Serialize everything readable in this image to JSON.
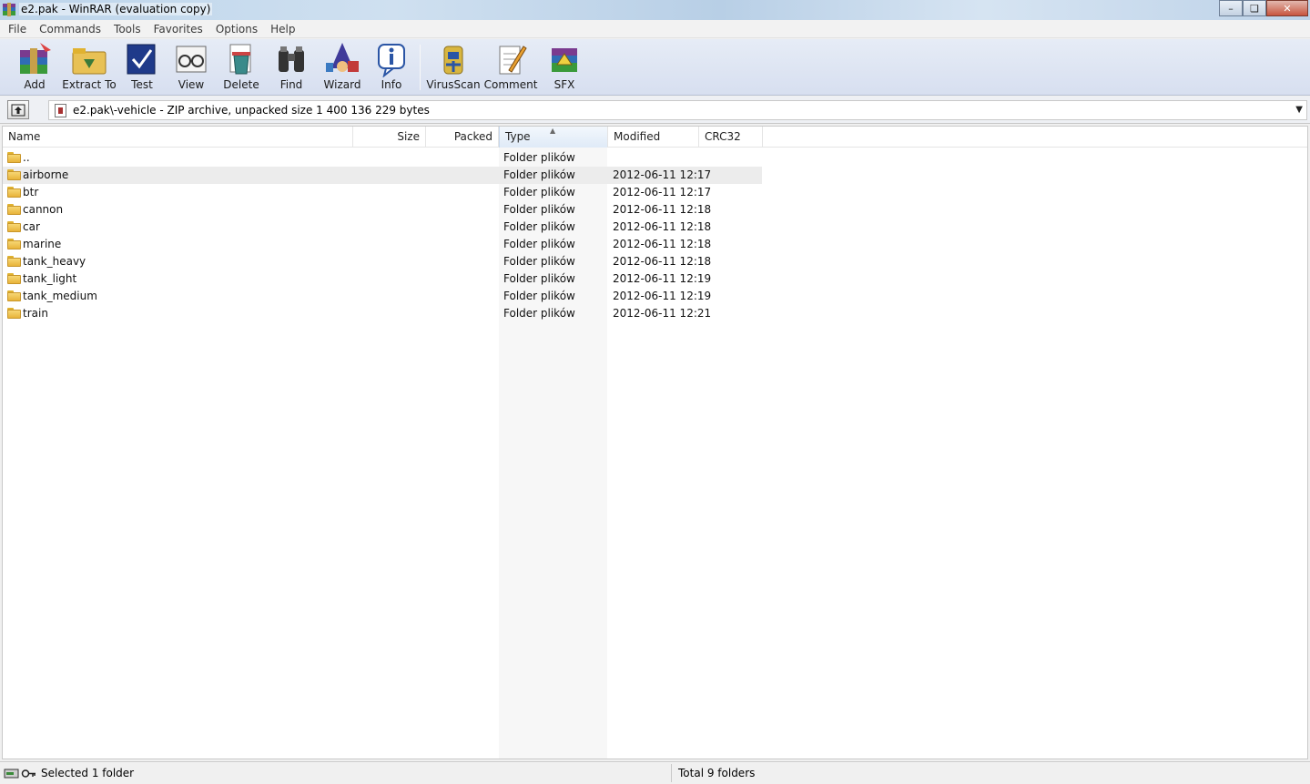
{
  "window": {
    "title": "e2.pak - WinRAR (evaluation copy)",
    "minimize_glyph": "–",
    "maximize_glyph": "❏",
    "close_glyph": "✕"
  },
  "menu": [
    "File",
    "Commands",
    "Tools",
    "Favorites",
    "Options",
    "Help"
  ],
  "toolbar": [
    {
      "label": "Add",
      "icon": "add-archive-icon"
    },
    {
      "label": "Extract To",
      "icon": "extract-to-icon"
    },
    {
      "label": "Test",
      "icon": "test-icon"
    },
    {
      "label": "View",
      "icon": "view-icon"
    },
    {
      "label": "Delete",
      "icon": "delete-icon"
    },
    {
      "label": "Find",
      "icon": "find-binoculars-icon"
    },
    {
      "label": "Wizard",
      "icon": "wizard-icon"
    },
    {
      "label": "Info",
      "icon": "info-icon"
    },
    {
      "label": "VirusScan",
      "icon": "virusscan-icon"
    },
    {
      "label": "Comment",
      "icon": "comment-icon"
    },
    {
      "label": "SFX",
      "icon": "sfx-icon"
    }
  ],
  "address": {
    "path": "e2.pak\\-vehicle - ZIP archive, unpacked size 1 400 136 229 bytes",
    "dropdown_glyph": "▼"
  },
  "columns": {
    "name": "Name",
    "size": "Size",
    "packed": "Packed",
    "type": "Type",
    "modified": "Modified",
    "crc": "CRC32"
  },
  "sort_arrow": "▲",
  "rows": [
    {
      "name": "..",
      "type": "Folder plików",
      "modified": ""
    },
    {
      "name": "airborne",
      "type": "Folder plików",
      "modified": "2012-06-11 12:17"
    },
    {
      "name": "btr",
      "type": "Folder plików",
      "modified": "2012-06-11 12:17"
    },
    {
      "name": "cannon",
      "type": "Folder plików",
      "modified": "2012-06-11 12:18"
    },
    {
      "name": "car",
      "type": "Folder plików",
      "modified": "2012-06-11 12:18"
    },
    {
      "name": "marine",
      "type": "Folder plików",
      "modified": "2012-06-11 12:18"
    },
    {
      "name": "tank_heavy",
      "type": "Folder plików",
      "modified": "2012-06-11 12:18"
    },
    {
      "name": "tank_light",
      "type": "Folder plików",
      "modified": "2012-06-11 12:19"
    },
    {
      "name": "tank_medium",
      "type": "Folder plików",
      "modified": "2012-06-11 12:19"
    },
    {
      "name": "train",
      "type": "Folder plików",
      "modified": "2012-06-11 12:21"
    }
  ],
  "status": {
    "left": "Selected 1 folder",
    "right": "Total 9 folders"
  },
  "colors": {
    "folder": "#e8b43a",
    "hover_row": "#ececec",
    "sorted_column": "#f7f7f7"
  }
}
